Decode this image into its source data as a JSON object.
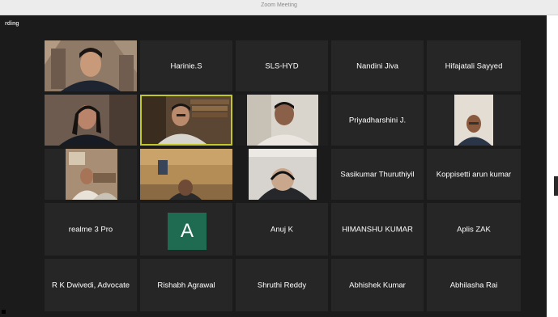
{
  "window": {
    "title": "Zoom Meeting"
  },
  "status": {
    "recording_label": "rding"
  },
  "participants": {
    "t1": "",
    "t2": "Harinie.S",
    "t3": "SLS-HYD",
    "t4": "Nandini Jiva",
    "t5": "Hifajatali Sayyed",
    "t6": "",
    "t7": "",
    "t8": "",
    "t9": "Priyadharshini J.",
    "t10": "",
    "t11": "",
    "t12": "",
    "t13": "",
    "t14": "Sasikumar Thuruthiyil",
    "t15": "Koppisetti arun kumar",
    "t16": "realme 3 Pro",
    "t17_initial": "A",
    "t18": "Anuj K",
    "t19": "HIMANSHU KUMAR",
    "t20": "Aplis ZAK",
    "t21": "R K Dwivedi, Advocate",
    "t22": "Rishabh Agrawal",
    "t23": "Shruthi Reddy",
    "t24": "Abhishek Kumar",
    "t25": "Abhilasha Rai"
  },
  "colors": {
    "active_speaker_border": "#c3c82a",
    "avatar_bg": "#1e6b52",
    "tile_bg": "#262626"
  }
}
